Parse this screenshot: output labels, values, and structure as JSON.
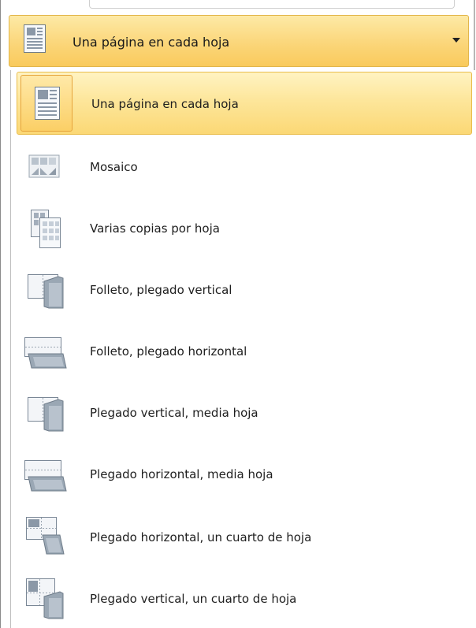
{
  "combo": {
    "selected_label": "Una página en cada hoja",
    "icon": "single-page-icon",
    "arrow_icon": "dropdown-arrow-icon"
  },
  "menu": {
    "items": [
      {
        "label": "Una página en cada hoja",
        "icon": "single-page-icon",
        "selected": true
      },
      {
        "label": "Mosaico",
        "icon": "tiled-pages-icon"
      },
      {
        "label": "Varias copias por hoja",
        "icon": "multiple-copies-icon"
      },
      {
        "label": "Folleto, plegado vertical",
        "icon": "booklet-side-fold-icon"
      },
      {
        "label": "Folleto, plegado horizontal",
        "icon": "booklet-top-fold-icon"
      },
      {
        "label": "Plegado vertical, media hoja",
        "icon": "side-fold-half-sheet-icon"
      },
      {
        "label": "Plegado horizontal, media hoja",
        "icon": "top-fold-half-sheet-icon"
      },
      {
        "label": "Plegado horizontal, un cuarto de hoja",
        "icon": "top-fold-quarter-sheet-icon"
      },
      {
        "label": "Plegado vertical, un cuarto de hoja",
        "icon": "side-fold-quarter-sheet-icon"
      }
    ]
  },
  "colors": {
    "highlight_top": "#fff3c2",
    "highlight_bottom": "#fbd875",
    "highlight_border": "#e9bd4c",
    "icon_border": "#7a8796",
    "icon_fill": "#dfe6ee"
  }
}
